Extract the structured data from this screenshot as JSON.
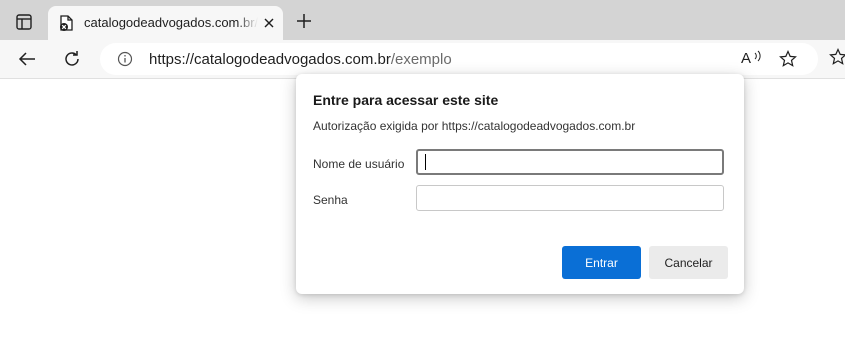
{
  "browser": {
    "tab": {
      "title": "catalogodeadvogados.com.br/exemplo",
      "favicon": "blocked-page-icon"
    },
    "address": {
      "host": "https://catalogodeadvogados.com.br",
      "path": "/exemplo"
    },
    "read_aloud_label": "A",
    "icons": {
      "tab_actions": "tab-actions-icon",
      "close": "close-icon",
      "new_tab": "plus-icon",
      "back": "back-arrow-icon",
      "refresh": "refresh-icon",
      "site_info": "info-icon",
      "read_aloud": "read-aloud-icon",
      "favorite": "star-icon"
    }
  },
  "dialog": {
    "title": "Entre para acessar este site",
    "subtitle": "Autorização exigida por https://catalogodeadvogados.com.br",
    "username_label": "Nome de usuário",
    "username_value": "",
    "password_label": "Senha",
    "password_value": "",
    "submit_label": "Entrar",
    "cancel_label": "Cancelar"
  },
  "colors": {
    "primary_button": "#0a6fd6",
    "tab_strip": "#d4d4d4",
    "toolbar": "#f7f7f7"
  }
}
